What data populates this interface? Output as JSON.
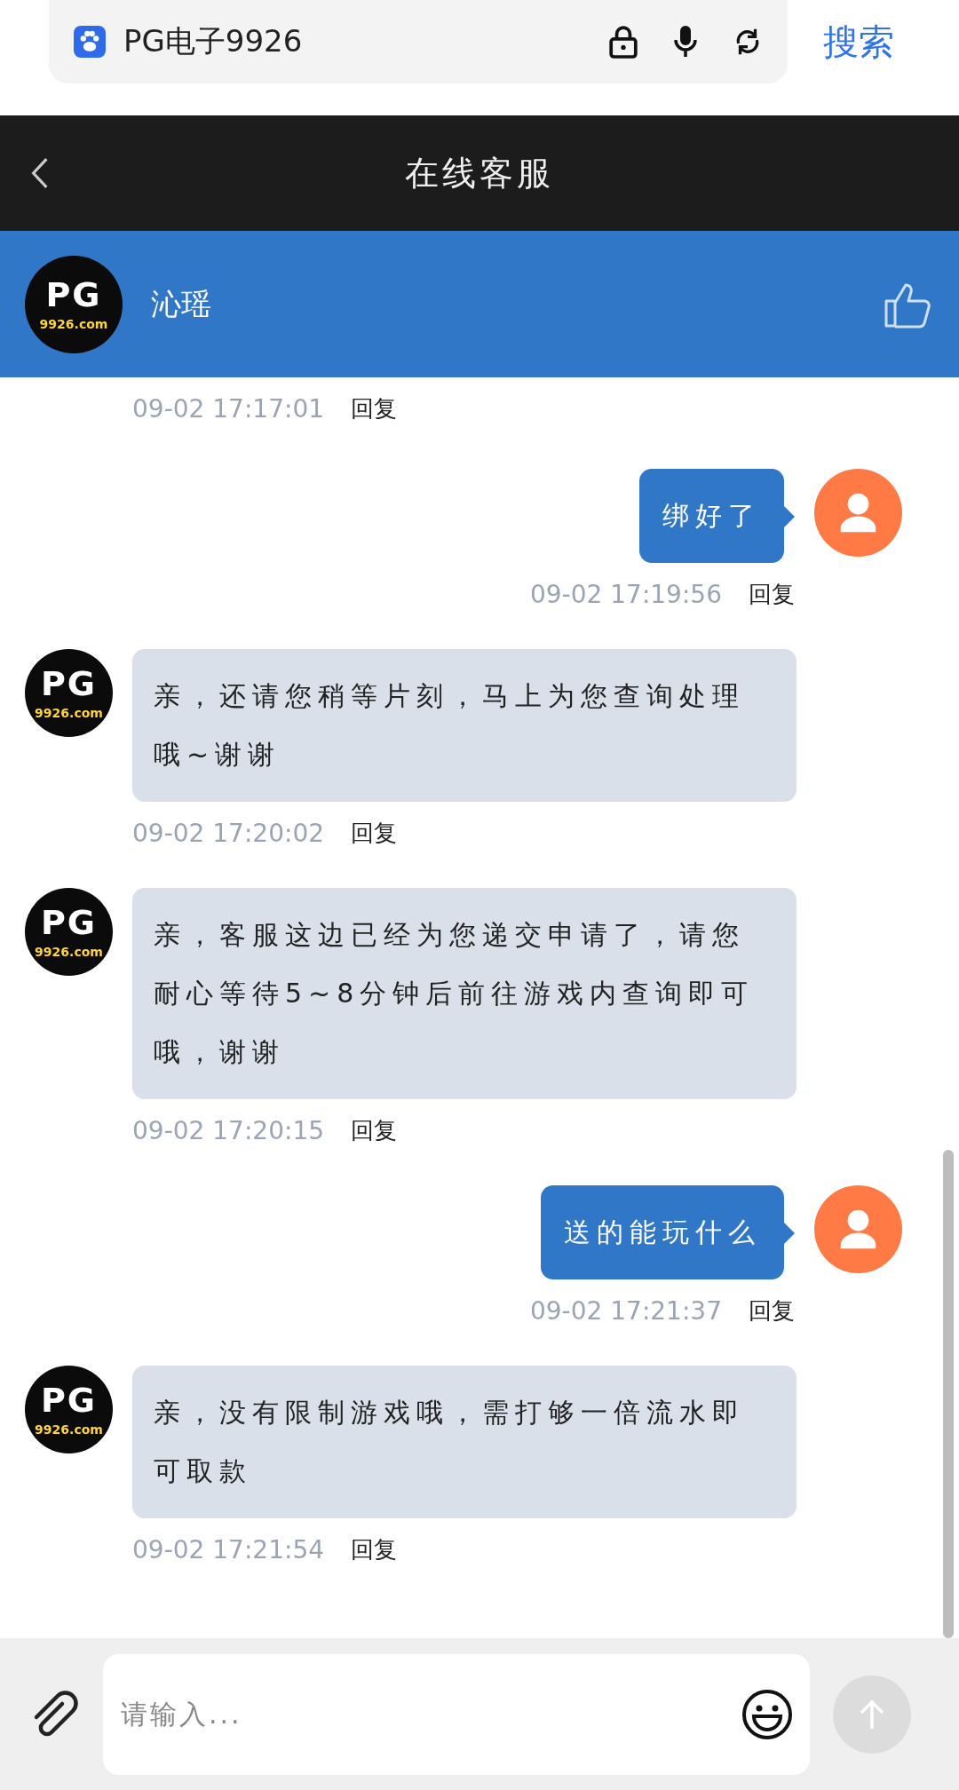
{
  "browser": {
    "address": "PG电子9926",
    "search_button": "搜索"
  },
  "nav": {
    "title": "在线客服"
  },
  "agent": {
    "name": "沁瑶",
    "logo": "PG",
    "logo_domain": "9926.com"
  },
  "messages": [
    {
      "kind": "agent",
      "time": "09-02 17:17:01",
      "reply": "回复"
    },
    {
      "kind": "user",
      "text": "绑好了",
      "time": "09-02 17:19:56",
      "reply": "回复"
    },
    {
      "kind": "agent",
      "text": "亲，还请您稍等片刻，马上为您查询处理哦~谢谢",
      "time": "09-02 17:20:02",
      "reply": "回复",
      "logo": "PG",
      "logo_domain": "9926.com"
    },
    {
      "kind": "agent",
      "text": "亲，客服这边已经为您递交申请了，请您耐心等待5~8分钟后前往游戏内查询即可哦，谢谢",
      "time": "09-02 17:20:15",
      "reply": "回复",
      "logo": "PG",
      "logo_domain": "9926.com"
    },
    {
      "kind": "user",
      "text": "送的能玩什么",
      "time": "09-02 17:21:37",
      "reply": "回复"
    },
    {
      "kind": "agent",
      "text": "亲，没有限制游戏哦，需打够一倍流水即可取款",
      "time": "09-02 17:21:54",
      "reply": "回复",
      "logo": "PG",
      "logo_domain": "9926.com"
    }
  ],
  "composer": {
    "placeholder": "请输入..."
  }
}
